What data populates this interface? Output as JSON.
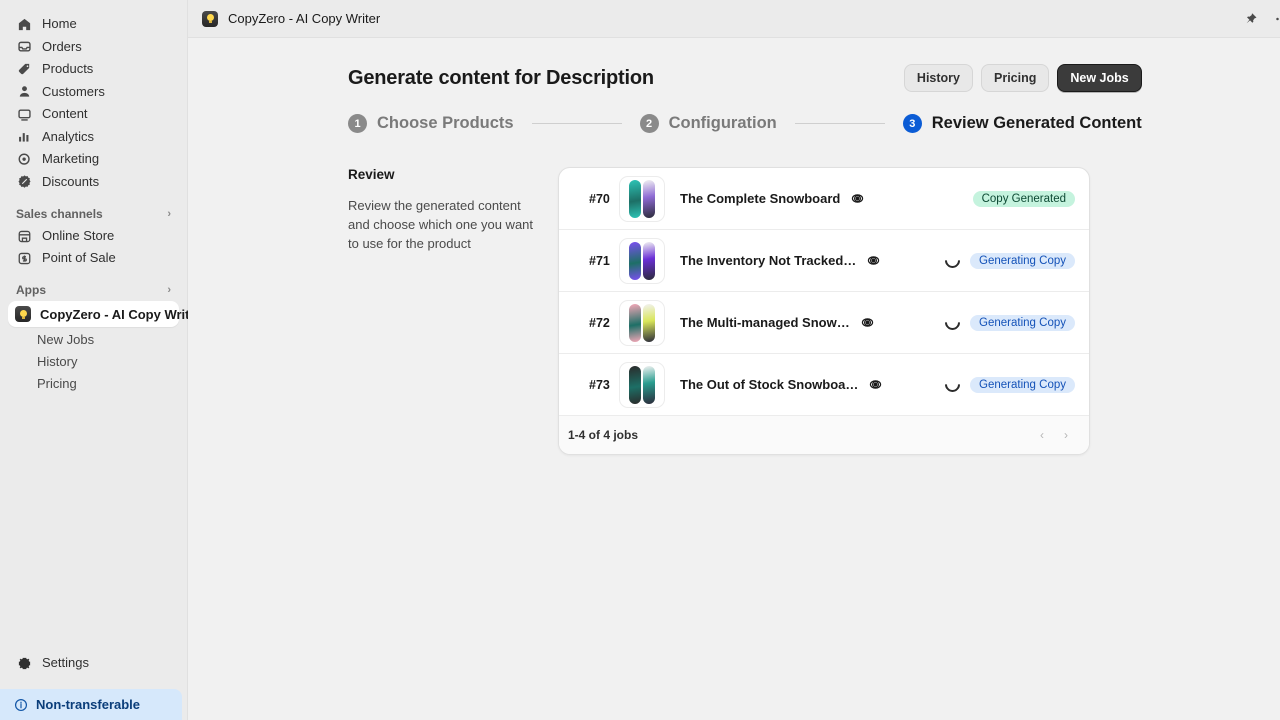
{
  "sidebar": {
    "nav_items": [
      {
        "label": "Home",
        "icon": "home-icon"
      },
      {
        "label": "Orders",
        "icon": "orders-icon"
      },
      {
        "label": "Products",
        "icon": "products-icon"
      },
      {
        "label": "Customers",
        "icon": "customers-icon"
      },
      {
        "label": "Content",
        "icon": "content-icon"
      },
      {
        "label": "Analytics",
        "icon": "analytics-icon"
      },
      {
        "label": "Marketing",
        "icon": "marketing-icon"
      },
      {
        "label": "Discounts",
        "icon": "discounts-icon"
      }
    ],
    "sales_channels": {
      "label": "Sales channels",
      "chevron": "›"
    },
    "channel_items": [
      {
        "label": "Online Store",
        "icon": "store-icon"
      },
      {
        "label": "Point of Sale",
        "icon": "pos-icon"
      }
    ],
    "apps": {
      "label": "Apps",
      "chevron": "›"
    },
    "active_app": {
      "label": "CopyZero - AI Copy Writer",
      "icon": "copyzero-app-icon"
    },
    "app_subitems": [
      {
        "label": "New Jobs"
      },
      {
        "label": "History"
      },
      {
        "label": "Pricing"
      }
    ],
    "settings": {
      "label": "Settings",
      "icon": "gear-icon"
    },
    "banner": {
      "label": "Non-transferable",
      "icon": "info-icon"
    }
  },
  "topbar": {
    "app_title": "CopyZero - AI Copy Writer",
    "app_icon": "copyzero-app-icon",
    "pin_icon": "pin-icon",
    "more_icon": "more-horizontal-icon"
  },
  "page": {
    "title": "Generate content for Description",
    "buttons": [
      {
        "label": "History",
        "style": "plain"
      },
      {
        "label": "Pricing",
        "style": "plain"
      },
      {
        "label": "New Jobs",
        "style": "dark"
      }
    ]
  },
  "stepper": {
    "steps": [
      {
        "num": "1",
        "label": "Choose Products",
        "active": false
      },
      {
        "num": "2",
        "label": "Configuration",
        "active": false
      },
      {
        "num": "3",
        "label": "Review Generated Content",
        "active": true
      }
    ]
  },
  "review": {
    "title": "Review",
    "description": "Review the generated content and choose which one you want to use for the product"
  },
  "jobs": {
    "columns": [
      "id",
      "thumbnail",
      "title",
      "preview",
      "status"
    ],
    "rows": [
      {
        "id": "#70",
        "title": "The Complete Snowboard",
        "status": "Copy Generated",
        "status_type": "done",
        "spinner": false,
        "boards": [
          "#2ec4b6",
          "#8e6bd4"
        ]
      },
      {
        "id": "#71",
        "title": "The Inventory Not Tracked…",
        "status": "Generating Copy",
        "status_type": "loading",
        "spinner": true,
        "boards": [
          "#7b4ff0",
          "#6a2fd6"
        ]
      },
      {
        "id": "#72",
        "title": "The Multi-managed Snow…",
        "status": "Generating Copy",
        "status_type": "loading",
        "spinner": true,
        "boards": [
          "#f6a8b8",
          "#d9e65a"
        ]
      },
      {
        "id": "#73",
        "title": "The Out of Stock Snowboa…",
        "status": "Generating Copy",
        "status_type": "loading",
        "spinner": true,
        "boards": [
          "#2b2b2b",
          "#2a9d8f"
        ]
      }
    ],
    "footer": {
      "text": "1-4 of 4 jobs",
      "prev": "‹",
      "next": "›"
    }
  },
  "colors": {
    "accent_blue": "#0b5cd5",
    "badge_green_bg": "#c5f3de",
    "badge_green_fg": "#0d4a34",
    "badge_blue_bg": "#dbe9fb",
    "badge_blue_fg": "#1452b8",
    "sidebar_bg": "#ebebeb",
    "main_bg": "#f1f1f1"
  }
}
